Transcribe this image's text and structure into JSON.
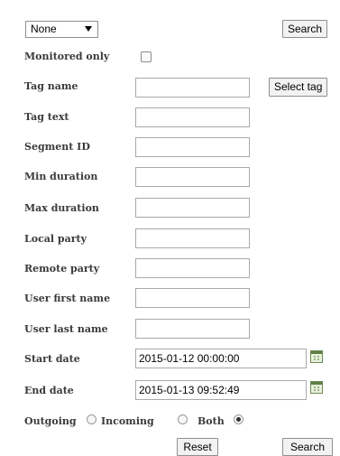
{
  "filter": {
    "select_value": "None",
    "search_top_label": "Search"
  },
  "labels": {
    "monitored_only": "Monitored only",
    "tag_name": "Tag name",
    "tag_text": "Tag text",
    "segment_id": "Segment ID",
    "min_duration": "Min duration",
    "max_duration": "Max duration",
    "local_party": "Local party",
    "remote_party": "Remote party",
    "user_first_name": "User first name",
    "user_last_name": "User last name",
    "start_date": "Start date",
    "end_date": "End date"
  },
  "values": {
    "monitored_only_checked": false,
    "tag_name": "",
    "tag_text": "",
    "segment_id": "",
    "min_duration": "",
    "max_duration": "",
    "local_party": "",
    "remote_party": "",
    "user_first_name": "",
    "user_last_name": "",
    "start_date": "2015-01-12 00:00:00",
    "end_date": "2015-01-13 09:52:49"
  },
  "buttons": {
    "select_tag": "Select tag",
    "reset": "Reset",
    "search_bottom": "Search"
  },
  "direction": {
    "options": [
      "Outgoing",
      "Incoming",
      "Both"
    ],
    "selected": "Both"
  },
  "icons": {
    "calendar": "calendar-icon"
  }
}
